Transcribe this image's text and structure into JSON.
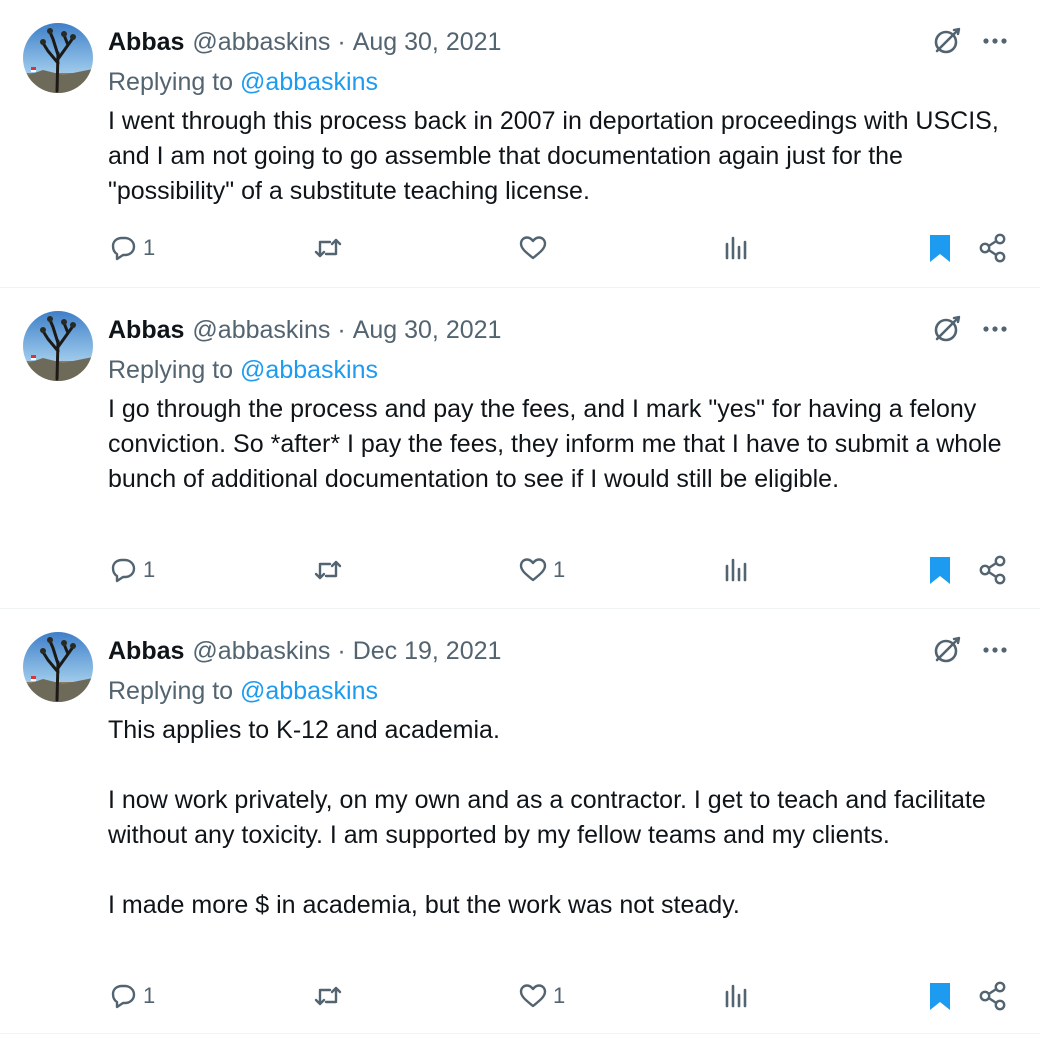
{
  "colors": {
    "text": "#0f1419",
    "secondary": "#536471",
    "accent": "#1d9bf0",
    "divider": "#eff3f4"
  },
  "icons": {
    "reply": "speech-bubble-icon",
    "retweet": "repost-arrows-icon",
    "like": "heart-icon",
    "views": "bar-chart-icon",
    "bookmark": "bookmark-filled-icon",
    "share": "share-nodes-icon",
    "grok": "grok-slash-icon",
    "more": "ellipsis-icon"
  },
  "tweets": [
    {
      "name": "Abbas",
      "handle": "@abbaskins",
      "separator": "·",
      "date": "Aug 30, 2021",
      "replying_prefix": "Replying to",
      "replying_to": "@abbaskins",
      "paragraphs": [
        "I went through this process back in 2007 in deportation proceedings with USCIS, and I am not going to go assemble that documentation again just for the \"possibility\" of a substitute teaching license."
      ],
      "reply_count": "1",
      "retweet_count": "",
      "like_count": ""
    },
    {
      "name": "Abbas",
      "handle": "@abbaskins",
      "separator": "·",
      "date": "Aug 30, 2021",
      "replying_prefix": "Replying to",
      "replying_to": "@abbaskins",
      "paragraphs": [
        "I go through the process and pay the fees, and I mark \"yes\" for having a felony conviction.  So *after* I pay the fees, they inform me that I have to submit a whole bunch of additional documentation to see if I would still be eligible."
      ],
      "reply_count": "1",
      "retweet_count": "",
      "like_count": "1"
    },
    {
      "name": "Abbas",
      "handle": "@abbaskins",
      "separator": "·",
      "date": "Dec 19, 2021",
      "replying_prefix": "Replying to",
      "replying_to": "@abbaskins",
      "paragraphs": [
        "This applies to K-12 and academia.",
        "I now work privately, on my own and as a contractor. I get to teach and facilitate without any toxicity. I am supported by my fellow teams and my clients.",
        "I made more $ in academia, but the work was not steady."
      ],
      "reply_count": "1",
      "retweet_count": "",
      "like_count": "1"
    }
  ]
}
